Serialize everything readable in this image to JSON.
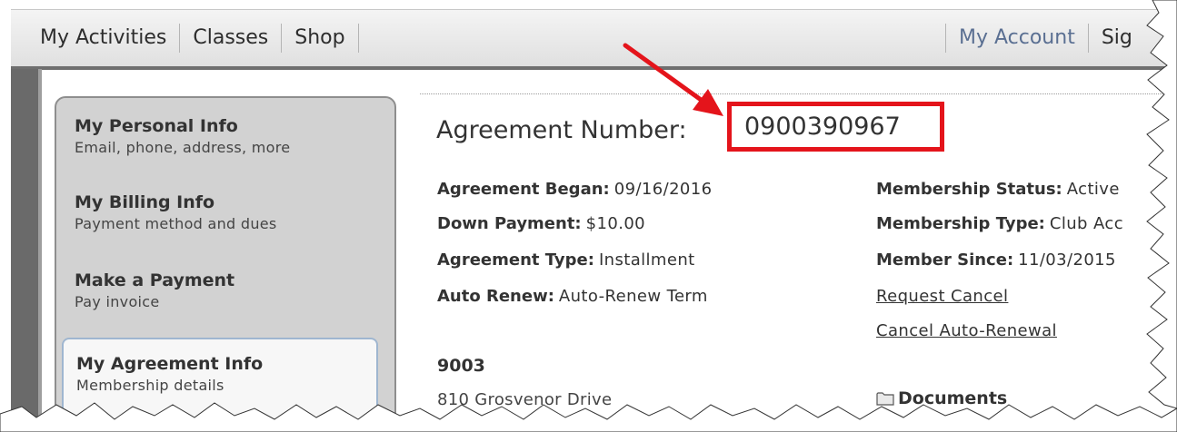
{
  "nav": {
    "left": [
      "My Activities",
      "Classes",
      "Shop"
    ],
    "right": [
      "My Account",
      "Sig"
    ]
  },
  "sidebar": {
    "items": [
      {
        "title": "My Personal Info",
        "subtitle": "Email, phone, address, more"
      },
      {
        "title": "My Billing Info",
        "subtitle": "Payment method and dues"
      },
      {
        "title": "Make a Payment",
        "subtitle": "Pay invoice"
      },
      {
        "title": "My Agreement Info",
        "subtitle": "Membership details"
      }
    ]
  },
  "agreement": {
    "heading": "Agreement Number",
    "number": "0900390967",
    "left_fields": [
      {
        "label": "Agreement Began:",
        "value": "09/16/2016"
      },
      {
        "label": "Down Payment:",
        "value": "$10.00"
      },
      {
        "label": "Agreement Type:",
        "value": "Installment"
      },
      {
        "label": "Auto Renew:",
        "value": "Auto-Renew Term"
      }
    ],
    "right_fields": [
      {
        "label": "Membership Status:",
        "value": "Active"
      },
      {
        "label": "Membership Type:",
        "value": "Club Acc"
      },
      {
        "label": "Member Since:",
        "value": "11/03/2015"
      }
    ],
    "links": [
      "Request Cancel",
      "Cancel Auto-Renewal"
    ],
    "address_number": "9003",
    "address_street": "810 Grosvenor Drive",
    "documents_label": "Documents"
  },
  "colors": {
    "highlight": "#e4141b",
    "nav_link": "#5a6f92",
    "sidebar_bg": "#d2d2d2",
    "active_border": "#9fb6d0"
  },
  "icons": {
    "folder": "folder-icon",
    "arrow": "annotation-arrow"
  }
}
